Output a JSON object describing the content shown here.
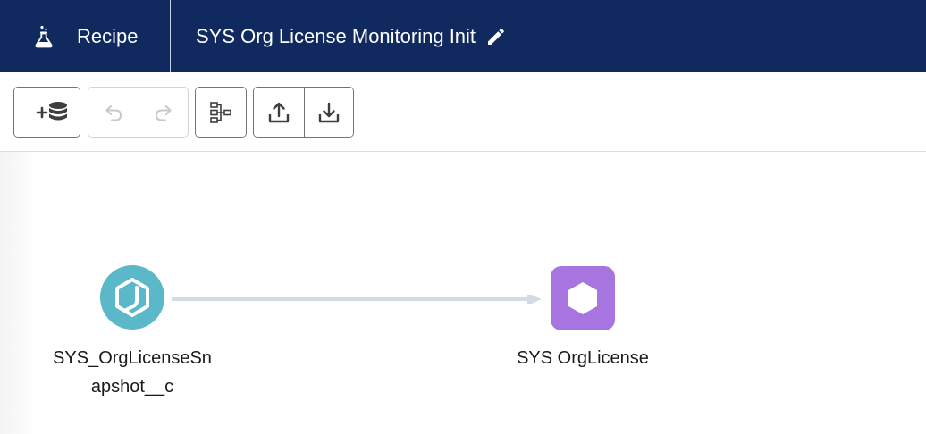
{
  "header": {
    "app_name": "Recipe",
    "recipe_title": "SYS Org License Monitoring Init",
    "app_icon": "flask-icon",
    "edit_icon": "pencil-icon"
  },
  "toolbar": {
    "buttons": [
      {
        "name": "add-input-data",
        "icon": "plus-database-icon",
        "enabled": true
      },
      {
        "name": "undo",
        "icon": "undo-icon",
        "enabled": false
      },
      {
        "name": "redo",
        "icon": "redo-icon",
        "enabled": false
      },
      {
        "name": "auto-layout",
        "icon": "hierarchy-icon",
        "enabled": true
      },
      {
        "name": "upload",
        "icon": "upload-icon",
        "enabled": true
      },
      {
        "name": "download",
        "icon": "download-icon",
        "enabled": true
      }
    ]
  },
  "graph": {
    "source_node": {
      "label_line1": "SYS_OrgLicenseSn",
      "label_line2": "apshot__c",
      "color": "#5ab8c8",
      "icon": "input-object-icon"
    },
    "target_node": {
      "label": "SYS OrgLicense",
      "color": "#a874e0",
      "icon": "hexagon-output-icon"
    },
    "edge_color": "#d4dbe6"
  },
  "colors": {
    "header_bg": "#10295e",
    "header_text": "#ffffff"
  }
}
